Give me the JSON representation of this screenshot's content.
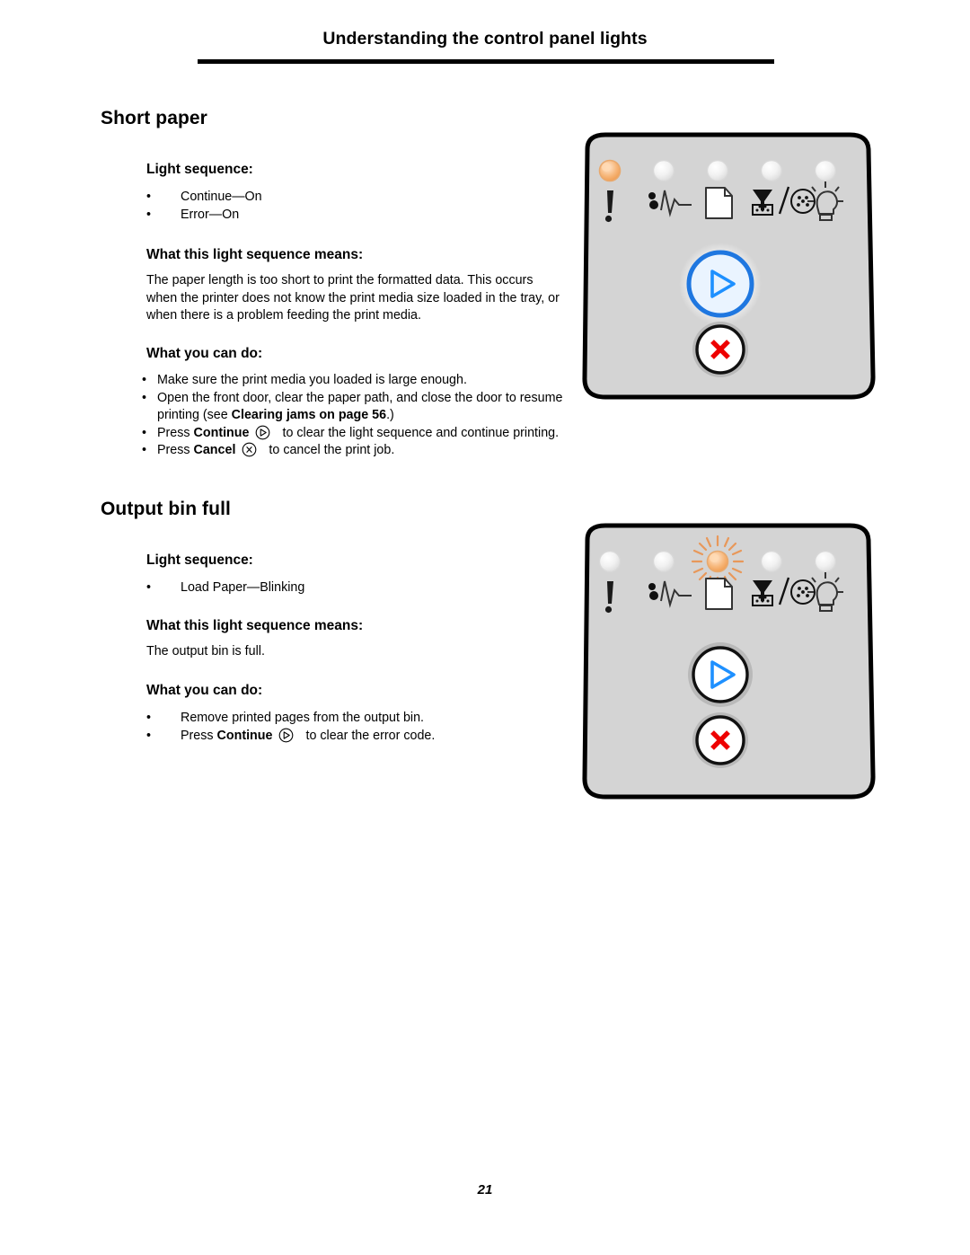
{
  "header": {
    "title": "Understanding the control panel lights"
  },
  "page_number": "21",
  "sections": [
    {
      "title": "Short paper",
      "light_sequence_label": "Light sequence:",
      "light_sequence_items": [
        "Continue—On",
        "Error—On"
      ],
      "means_label": "What this light sequence means:",
      "means_text": "The paper length is too short to print the formatted data. This occurs when the printer does not know the print media size loaded in the tray, or when there is a problem feeding the print media.",
      "actions_label": "What you can do:",
      "actions": [
        {
          "text_before": "Make sure the print media you loaded is large enough.",
          "bold": "",
          "text_after": "",
          "icon": ""
        },
        {
          "text_before": "Open the front door, clear the paper path, and close the door to resume printing (see ",
          "bold": "Clearing jams on page 56",
          "text_after": ".)",
          "icon": ""
        },
        {
          "text_before": "Press ",
          "bold": "Continue",
          "icon": "continue-key-icon",
          "text_after": "to clear the light sequence and continue printing."
        },
        {
          "text_before": "Press ",
          "bold": "Cancel",
          "icon": "cancel-key-icon",
          "text_after": "to cancel the print job."
        }
      ]
    },
    {
      "title": "Output bin full",
      "light_sequence_label": "Light sequence:",
      "light_sequence_items": [
        "Load Paper—Blinking"
      ],
      "means_label": "What this light sequence means:",
      "means_text": "The output bin is full.",
      "actions_label": "What you can do:",
      "actions": [
        {
          "text_before": "Remove printed pages from the output bin.",
          "bold": "",
          "text_after": "",
          "icon": ""
        },
        {
          "text_before": "Press ",
          "bold": "Continue",
          "icon": "continue-key-icon",
          "text_after": "to clear the error code."
        }
      ]
    }
  ],
  "panels": [
    {
      "name": "control-panel-short-paper",
      "leds": [
        {
          "icon": "error-exclamation-icon",
          "state": "on",
          "label": "Error"
        },
        {
          "icon": "paper-jam-icon",
          "state": "off",
          "label": "Paper Jam"
        },
        {
          "icon": "load-paper-icon",
          "state": "off",
          "label": "Load Paper"
        },
        {
          "icon": "toner-icon",
          "state": "off",
          "label": "Toner"
        },
        {
          "icon": "ready-lightbulb-icon",
          "state": "off",
          "label": "Ready"
        }
      ],
      "continue_button": {
        "icon": "continue-play-icon",
        "state": "lit"
      },
      "cancel_button": {
        "icon": "cancel-x-icon",
        "state": "off"
      }
    },
    {
      "name": "control-panel-output-bin-full",
      "leds": [
        {
          "icon": "error-exclamation-icon",
          "state": "off",
          "label": "Error"
        },
        {
          "icon": "paper-jam-icon",
          "state": "off",
          "label": "Paper Jam"
        },
        {
          "icon": "load-paper-icon",
          "state": "blinking",
          "label": "Load Paper"
        },
        {
          "icon": "toner-icon",
          "state": "off",
          "label": "Toner"
        },
        {
          "icon": "ready-lightbulb-icon",
          "state": "off",
          "label": "Ready"
        }
      ],
      "continue_button": {
        "icon": "continue-play-icon",
        "state": "off"
      },
      "cancel_button": {
        "icon": "cancel-x-icon",
        "state": "off"
      }
    }
  ],
  "colors": {
    "panel_fill": "#d4d4d4",
    "panel_stroke": "#000000",
    "led_on": "#f0a060",
    "led_off": "#eeeeee",
    "continue_blue": "#1e90ff",
    "cancel_red": "#ee0000"
  }
}
